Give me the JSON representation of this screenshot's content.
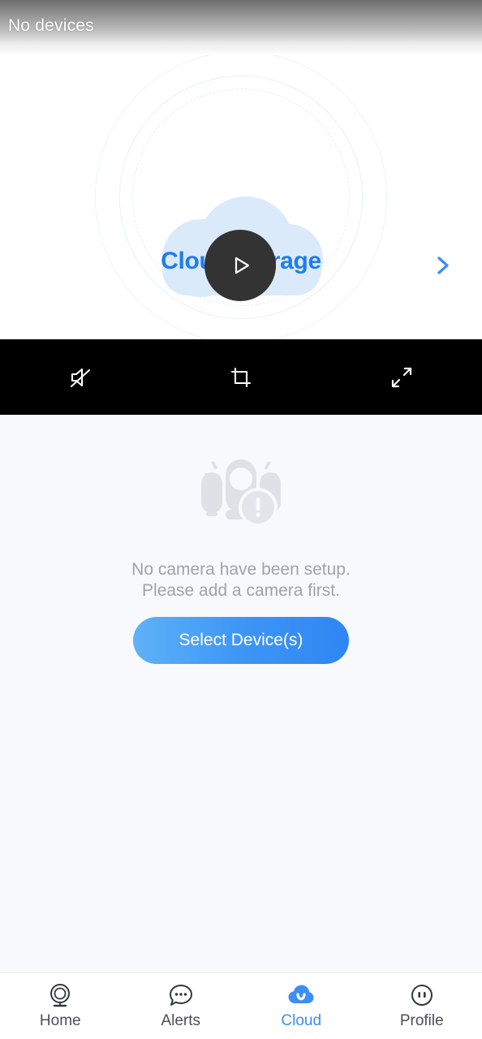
{
  "titlebar": {
    "title": "No devices"
  },
  "banner": {
    "title": "Cloud storage",
    "play_icon": "play-icon",
    "next_icon": "chevron-right-icon",
    "cloud_icon": "cloud-illustration",
    "accent_color": "#1e7cf0",
    "cloud_color": "#dbeafb",
    "play_button_color": "#333333"
  },
  "controls": [
    {
      "name": "mute-button",
      "icon": "speaker-muted-icon"
    },
    {
      "name": "crop-button",
      "icon": "crop-icon"
    },
    {
      "name": "fullscreen-button",
      "icon": "expand-arrows-icon"
    }
  ],
  "empty_state": {
    "illustration": "cameras-warning-icon",
    "line1": "No camera have been setup.",
    "line2": "Please add a camera first.",
    "text_color": "#9fa3a9",
    "button_label": "Select Device(s)",
    "button_color": "#3d96f5"
  },
  "bottom_nav": {
    "active_color": "#3d8ef5",
    "inactive_color": "#4a4f57",
    "items": [
      {
        "label": "Home",
        "icon": "camera-icon",
        "active": false
      },
      {
        "label": "Alerts",
        "icon": "chat-bubble-icon",
        "active": false
      },
      {
        "label": "Cloud",
        "icon": "cloud-icon",
        "active": true
      },
      {
        "label": "Profile",
        "icon": "face-circle-icon",
        "active": false
      }
    ]
  }
}
